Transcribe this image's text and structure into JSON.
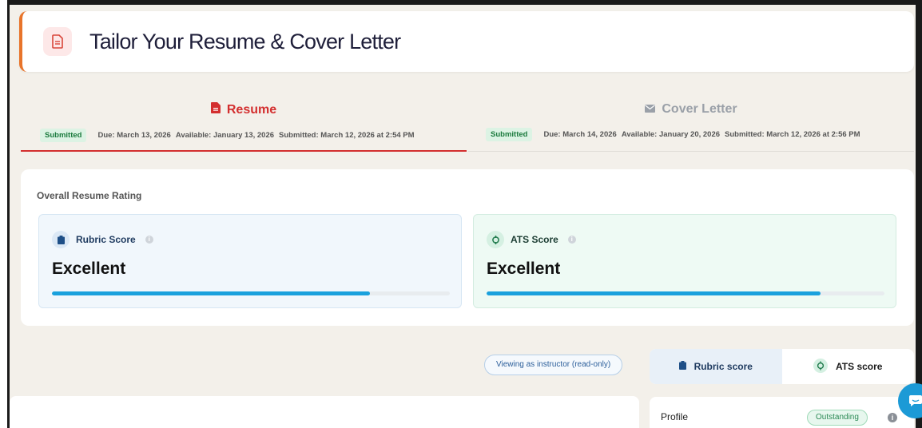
{
  "header": {
    "title": "Tailor Your Resume & Cover Letter",
    "icon": "document-icon",
    "accent_color": "#e8742a"
  },
  "tabs": [
    {
      "label": "Resume",
      "icon": "document-icon",
      "active": true,
      "status": "Submitted",
      "due": "Due: March 13, 2026",
      "available": "Available: January 13, 2026",
      "submitted": "Submitted: March 12, 2026 at 2:54 PM"
    },
    {
      "label": "Cover Letter",
      "icon": "envelope-icon",
      "active": false,
      "status": "Submitted",
      "due": "Due: March 14, 2026",
      "available": "Available: January 20, 2026",
      "submitted": "Submitted: March 12, 2026 at 2:56 PM"
    }
  ],
  "rating": {
    "label": "Overall Resume Rating",
    "rubric": {
      "title": "Rubric Score",
      "value": "Excellent",
      "progress": 0.8
    },
    "ats": {
      "title": "ATS Score",
      "value": "Excellent",
      "progress": 0.84
    }
  },
  "viewer": {
    "notice": "Viewing as instructor (read-only)"
  },
  "score_toggle": {
    "rubric_label": "Rubric score",
    "ats_label": "ATS score"
  },
  "profile": {
    "label": "Profile",
    "badge": "Outstanding"
  },
  "colors": {
    "active_tab": "#d32f2f",
    "progress_bar": "#1aa1dd",
    "submitted_badge_bg": "#dcf3e4",
    "submitted_badge_text": "#1a7a3d"
  }
}
